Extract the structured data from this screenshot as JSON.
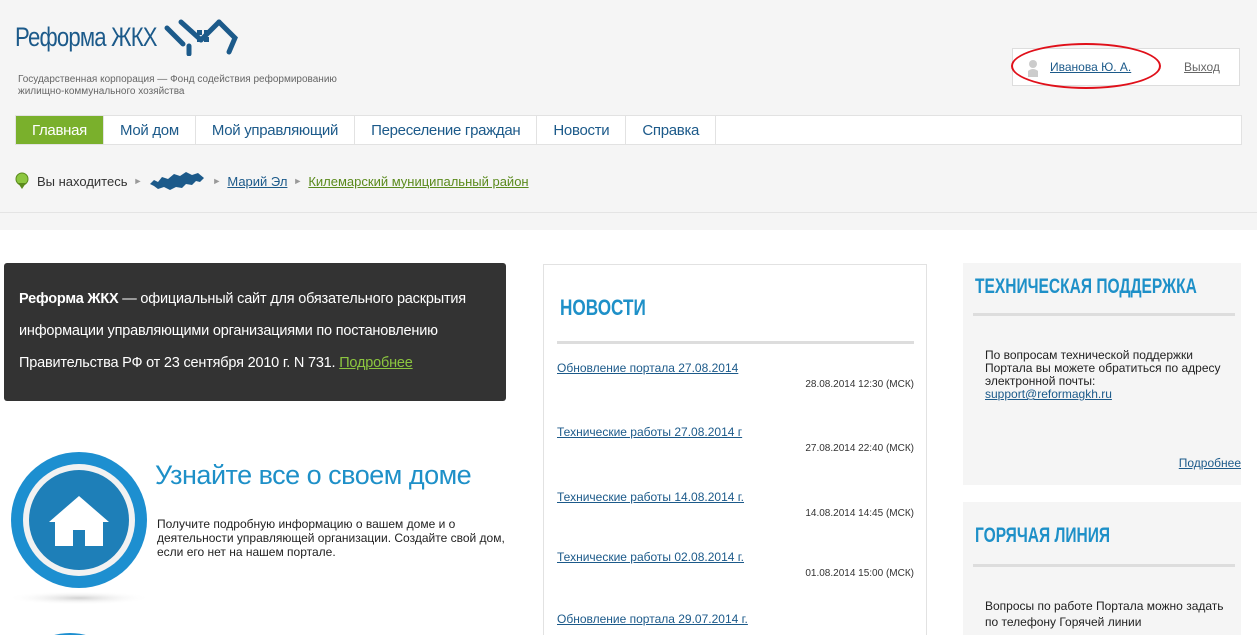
{
  "header": {
    "logo_title": "Реформа ЖКХ",
    "logo_subtitle": "Государственная корпорация — Фонд содействия реформированию жилищно-коммунального хозяйства",
    "user_name": "Иванова Ю. А.",
    "logout_label": "Выход",
    "highlight_color": "#e0101a"
  },
  "nav": {
    "items": [
      {
        "label": "Главная",
        "active": true
      },
      {
        "label": "Мой дом"
      },
      {
        "label": "Мой управляющий"
      },
      {
        "label": "Переселение граждан"
      },
      {
        "label": "Новости"
      },
      {
        "label": "Справка"
      }
    ],
    "accent": "#7ab02c"
  },
  "breadcrumb": {
    "label": "Вы находитесь",
    "region": "Марий Эл",
    "district": "Килемарский муниципальный район"
  },
  "about": {
    "brand": "Реформа ЖКХ",
    "text": " — официальный сайт для обязательного раскрытия информации управляющими организациями по постановлению Правительства РФ от 23 сентября 2010 г. N 731. ",
    "more_link": "Подробнее"
  },
  "house_promo": {
    "title": "Узнайте все о своем доме",
    "text": "Получите подробную информацию о вашем доме и о деятельности управляющей организации. Создайте свой дом, если его нет на нашем портале."
  },
  "news": {
    "title": "НОВОСТИ",
    "items": [
      {
        "title": "Обновление портала 27.08.2014",
        "date": "28.08.2014 12:30 (МСК)"
      },
      {
        "title": "Технические работы 27.08.2014 г",
        "date": "27.08.2014 22:40 (МСК)"
      },
      {
        "title": "Технические работы 14.08.2014 г.",
        "date": "14.08.2014 14:45 (МСК)"
      },
      {
        "title": "Технические работы 02.08.2014 г.",
        "date": "01.08.2014 15:00 (МСК)"
      },
      {
        "title": "Обновление портала 29.07.2014 г."
      }
    ]
  },
  "support": {
    "title": "ТЕХНИЧЕСКАЯ ПОДДЕРЖКА",
    "text": "По вопросам технической поддержки Портала вы можете обратиться по адресу электронной почты:",
    "email": "support@reformagkh.ru",
    "more_link": "Подробнее"
  },
  "hotline": {
    "title": "ГОРЯЧАЯ ЛИНИЯ",
    "text": "Вопросы по работе Портала можно задать по телефону Горячей линии"
  },
  "colors": {
    "brand_blue": "#1c5a8a",
    "heading_blue": "#1e90c8"
  }
}
